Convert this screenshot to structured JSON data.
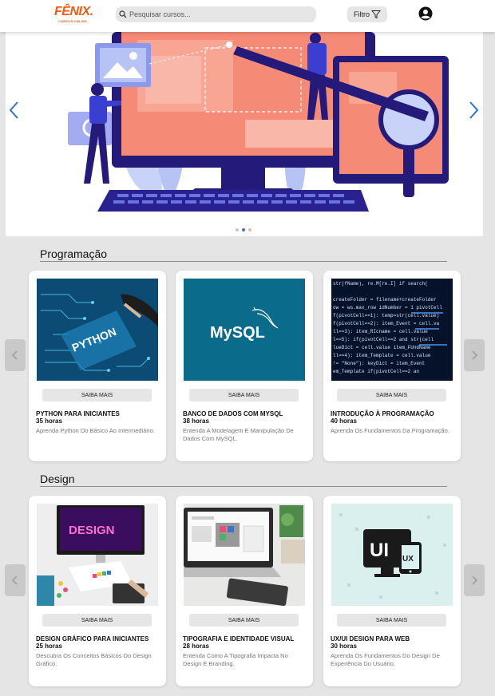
{
  "header": {
    "logo_main": "FÊNIX.",
    "logo_sub": "CURSOS ONLINE",
    "search_placeholder": "Pesquisar cursos...",
    "filter_label": "Filtro"
  },
  "colors": {
    "brand": "#f35b12",
    "accent_blue": "#2f6fd6",
    "page_bg": "#e5e5e5"
  },
  "carousel": {
    "slide_count": 3,
    "active_slide": 2
  },
  "sections": [
    {
      "title": "Programação",
      "courses": [
        {
          "title": "PYTHON PARA INICIANTES",
          "hours": "35 horas",
          "desc": "Aprenda Python Do Básico Ao Intermediário.",
          "button": "SAIBA MAIS"
        },
        {
          "title": "BANCO DE DADOS COM MYSQL",
          "hours": "38 horas",
          "desc": "Entenda A Modelagem E Manipulação De Dados Com MySQL.",
          "button": "SAIBA MAIS"
        },
        {
          "title": "INTRODUÇÃO À PROGRAMAÇÃO",
          "hours": "40 horas",
          "desc": "Aprenda Os Fundamentos Da Programação.",
          "button": "SAIBA MAIS"
        }
      ]
    },
    {
      "title": "Design",
      "courses": [
        {
          "title": "DESIGN GRÁFICO PARA INICIANTES",
          "hours": "25 horas",
          "desc": "Descubra Os Conceitos Básicos Do Design Gráfico.",
          "button": "SAIBA MAIS"
        },
        {
          "title": "TIPOGRAFIA E IDENTIDADE VISUAL",
          "hours": "28 horas",
          "desc": "Entenda Como A Tipografia Impacta No Design E Branding.",
          "button": "SAIBA MAIS"
        },
        {
          "title": "UX/UI DESIGN PARA WEB",
          "hours": "30 horas",
          "desc": "Aprenda Os Fundamentos Do Design De Experiência Do Usuário.",
          "button": "SAIBA MAIS"
        }
      ]
    }
  ],
  "images": {
    "python_text": "PYTHON",
    "mysql_text": "MySQL",
    "design_text": "DESIGN",
    "ui_text": "UI",
    "ux_text": "UX"
  }
}
